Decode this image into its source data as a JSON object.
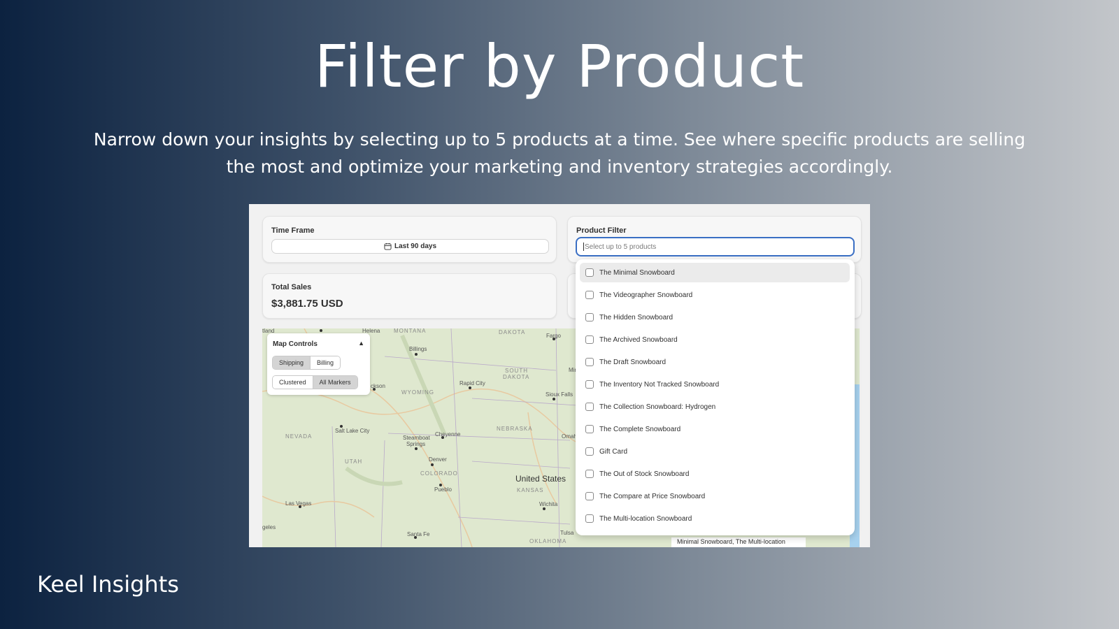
{
  "slide": {
    "title": "Filter by Product",
    "subtitle": "Narrow down your insights by selecting up to 5 products at a time. See where specific products are selling the most and optimize your marketing and inventory strategies accordingly.",
    "brand": "Keel Insights"
  },
  "app": {
    "time_frame": {
      "label": "Time Frame",
      "value": "Last 90 days",
      "icon": "calendar-icon"
    },
    "total_sales": {
      "label": "Total Sales",
      "value": "$3,881.75 USD"
    },
    "product_filter": {
      "label": "Product Filter",
      "placeholder": "Select up to 5 products"
    },
    "map_controls": {
      "title": "Map Controls",
      "toggle": "▲",
      "address_type": [
        "Shipping",
        "Billing"
      ],
      "address_active": "Shipping",
      "marker_mode": [
        "Clustered",
        "All Markers"
      ],
      "marker_active": "All Markers"
    },
    "map_labels": {
      "places": [
        "tland",
        "Helena",
        "Billings",
        "Fargo",
        "Rapid City",
        "Sioux Falls",
        "ckson",
        "Salt Lake City",
        "Cheyenne",
        "Steamboat",
        "Springs",
        "Denver",
        "Pueblo",
        "Omah",
        "Wichita",
        "Las Vegas",
        "Santa Fe",
        "Tulsa",
        "geles",
        "Min",
        "United States"
      ],
      "states": [
        "MONTANA",
        "DAKOTA",
        "SOUTH",
        "DAKOTA",
        "WYOMING",
        "NEVADA",
        "UTAH",
        "COLORADO",
        "NEBRASKA",
        "KANSAS",
        "OKLAHOMA"
      ],
      "tooltip": "Minimal Snowboard, The Multi-location"
    },
    "product_options": [
      "The Minimal Snowboard",
      "The Videographer Snowboard",
      "The Hidden Snowboard",
      "The Archived Snowboard",
      "The Draft Snowboard",
      "The Inventory Not Tracked Snowboard",
      "The Collection Snowboard: Hydrogen",
      "The Complete Snowboard",
      "Gift Card",
      "The Out of Stock Snowboard",
      "The Compare at Price Snowboard",
      "The Multi-location Snowboard"
    ]
  }
}
